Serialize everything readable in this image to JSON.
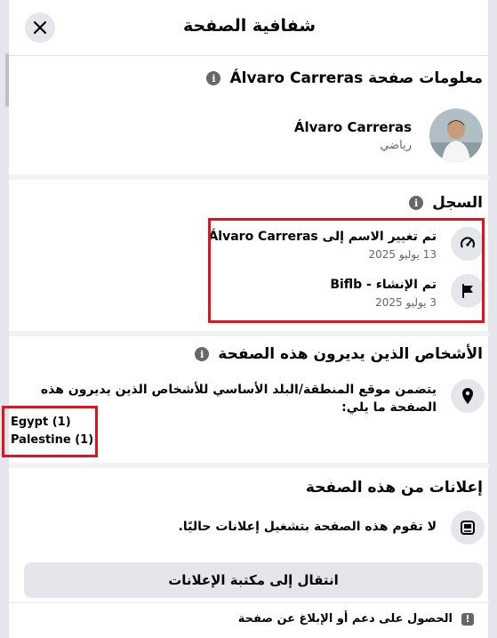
{
  "dialog": {
    "title": "شفافية الصفحة",
    "close_label": "إغلاق"
  },
  "page_info": {
    "heading": "معلومات صفحة Álvaro Carreras",
    "name": "Álvaro Carreras",
    "category": "رياضي"
  },
  "history": {
    "heading": "السجل",
    "items": [
      {
        "icon": "speedometer-icon",
        "title": "تم تغيير الاسم إلى Álvaro Carreras",
        "date": "13 يوليو 2025"
      },
      {
        "icon": "flag-icon",
        "title": "تم الإنشاء - Biflb",
        "date": "3 يوليو 2025"
      }
    ]
  },
  "managers": {
    "heading": "الأشخاص الذين يديرون هذه الصفحة",
    "description": "يتضمن موقع المنطقة/البلد الأساسي للأشخاص الذين يديرون هذه الصفحة ما يلي:",
    "countries": [
      "Egypt (1)",
      "Palestine (1)"
    ]
  },
  "ads": {
    "heading": "إعلانات من هذه الصفحة",
    "status": "لا تقوم هذه الصفحة بتشغيل إعلانات حاليًا.",
    "library_button": "انتقال إلى مكتبة الإعلانات"
  },
  "report": {
    "label": "الحصول على دعم أو الإبلاغ عن صفحة"
  },
  "colors": {
    "highlight": "#e0141e",
    "icon_bg": "#e4e6eb",
    "secondary_text": "#65676b"
  }
}
